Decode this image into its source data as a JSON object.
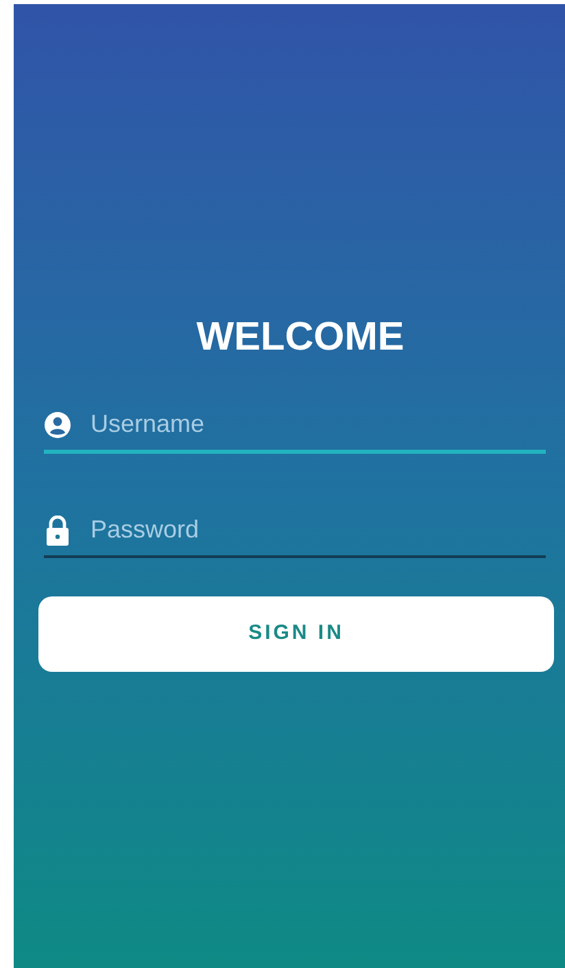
{
  "title": "WELCOME",
  "fields": [
    {
      "kind": "username",
      "placeholder": "Username",
      "focused": true
    },
    {
      "kind": "password",
      "placeholder": "Password",
      "focused": false
    }
  ],
  "sign_in_button": {
    "label": "SIGN IN"
  }
}
